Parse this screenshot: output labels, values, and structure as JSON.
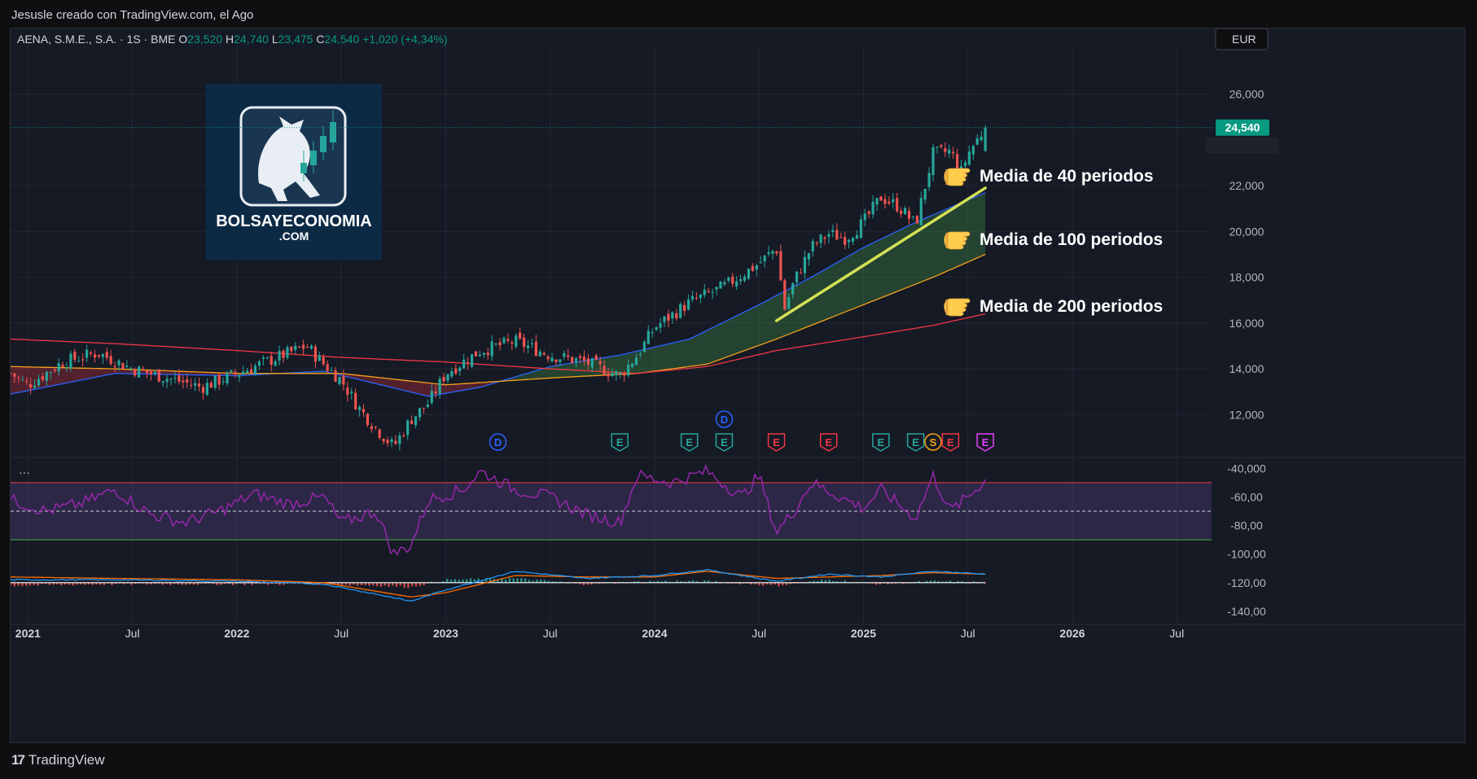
{
  "caption": "Jesusle creado con TradingView.com, el Ago",
  "footer": {
    "brand": "TradingView"
  },
  "legend": {
    "symbol": "AENA, S.M.E., S.A. · 1S · BME",
    "o_label": "O",
    "o_value": "23,520",
    "h_label": "H",
    "h_value": "24,740",
    "l_label": "L",
    "l_value": "23,475",
    "c_label": "C",
    "c_value": "24,540",
    "change": "+1,020 (+4,34%)"
  },
  "currency": "EUR",
  "last_price_label": "24,540",
  "logo": {
    "line1": "BOLSAYECONOMIA",
    "line2": ".COM"
  },
  "annotations": [
    {
      "text": "Media de 40 periodos",
      "icon": "pointing-hand-icon",
      "price": 21800
    },
    {
      "text": "Media de 100 periodos",
      "icon": "pointing-hand-icon",
      "price": 19200
    },
    {
      "text": "Media de 200 periodos",
      "icon": "pointing-hand-icon",
      "price": 16400
    }
  ],
  "indicator_menu": "···",
  "colors": {
    "up": "#26a69a",
    "down": "#ef5350",
    "sma40": "#2962ff",
    "sma100": "#f7a21b",
    "sma200": "#f23645",
    "rsi": "#9c27b0",
    "macd": "#2196f3",
    "signal": "#ff6d00",
    "trendline": "#d4e157",
    "accent": "#089981"
  },
  "chart_data": {
    "type": "candlestick",
    "title": "AENA, S.M.E., S.A. · 1S · BME",
    "price_axis": {
      "ticks": [
        "26,000",
        "22,000",
        "20,000",
        "18,000",
        "16,000",
        "14,000",
        "12,000"
      ],
      "tick_values": [
        26000,
        22000,
        20000,
        18000,
        16000,
        14000,
        12000
      ],
      "range": [
        10200,
        27800
      ]
    },
    "x_axis": {
      "labels": [
        "2021",
        "Jul",
        "2022",
        "Jul",
        "2023",
        "Jul",
        "2024",
        "Jul",
        "2025",
        "Jul",
        "2026",
        "Jul"
      ],
      "label_dates": [
        "2021-01",
        "2021-07",
        "2022-01",
        "2022-07",
        "2023-01",
        "2023-07",
        "2024-01",
        "2024-07",
        "2025-01",
        "2025-07",
        "2026-01",
        "2026-07"
      ],
      "range": [
        "2020-12",
        "2026-09"
      ]
    },
    "price_path": [
      [
        "2020-12",
        13800
      ],
      [
        "2021-01",
        13300
      ],
      [
        "2021-03",
        14300
      ],
      [
        "2021-05",
        14700
      ],
      [
        "2021-07",
        14000
      ],
      [
        "2021-09",
        13600
      ],
      [
        "2021-11",
        13200
      ],
      [
        "2022-01",
        13800
      ],
      [
        "2022-03",
        14400
      ],
      [
        "2022-05",
        15000
      ],
      [
        "2022-06",
        14200
      ],
      [
        "2022-07",
        13500
      ],
      [
        "2022-08",
        12300
      ],
      [
        "2022-09",
        11400
      ],
      [
        "2022-10",
        10600
      ],
      [
        "2022-11",
        11800
      ],
      [
        "2022-12",
        12500
      ],
      [
        "2023-01",
        13800
      ],
      [
        "2023-03",
        14800
      ],
      [
        "2023-05",
        15200
      ],
      [
        "2023-07",
        14600
      ],
      [
        "2023-09",
        14300
      ],
      [
        "2023-11",
        13700
      ],
      [
        "2023-12",
        14600
      ],
      [
        "2024-01",
        15800
      ],
      [
        "2024-03",
        16900
      ],
      [
        "2024-05",
        17600
      ],
      [
        "2024-07",
        18600
      ],
      [
        "2024-08",
        19300
      ],
      [
        "2024-08-15",
        16600
      ],
      [
        "2024-09",
        17800
      ],
      [
        "2024-10",
        19300
      ],
      [
        "2024-11",
        19900
      ],
      [
        "2024-12",
        19700
      ],
      [
        "2025-01",
        20400
      ],
      [
        "2025-02",
        21500
      ],
      [
        "2025-03",
        21100
      ],
      [
        "2025-04",
        20300
      ],
      [
        "2025-05",
        23400
      ],
      [
        "2025-06",
        23500
      ],
      [
        "2025-06-20",
        22600
      ],
      [
        "2025-07",
        23400
      ],
      [
        "2025-08",
        24540
      ]
    ],
    "series": [
      {
        "name": "Media de 40 periodos",
        "values": [
          [
            "2020-12",
            12900
          ],
          [
            "2021-06",
            13800
          ],
          [
            "2022-01",
            13700
          ],
          [
            "2022-06",
            13900
          ],
          [
            "2022-12",
            12800
          ],
          [
            "2023-03",
            13200
          ],
          [
            "2023-07",
            14100
          ],
          [
            "2023-11",
            14600
          ],
          [
            "2024-03",
            15300
          ],
          [
            "2024-07",
            16800
          ],
          [
            "2024-10",
            18000
          ],
          [
            "2025-01",
            19300
          ],
          [
            "2025-04",
            20400
          ],
          [
            "2025-08",
            21700
          ]
        ]
      },
      {
        "name": "Media de 100 periodos",
        "values": [
          [
            "2020-12",
            14100
          ],
          [
            "2021-06",
            14000
          ],
          [
            "2022-01",
            13800
          ],
          [
            "2022-07",
            13800
          ],
          [
            "2023-01",
            13300
          ],
          [
            "2023-07",
            13600
          ],
          [
            "2023-12",
            13800
          ],
          [
            "2024-04",
            14200
          ],
          [
            "2024-08",
            15300
          ],
          [
            "2025-01",
            16800
          ],
          [
            "2025-05",
            18000
          ],
          [
            "2025-08",
            19000
          ]
        ]
      },
      {
        "name": "Media de 200 periodos",
        "values": [
          [
            "2020-12",
            15300
          ],
          [
            "2021-06",
            15100
          ],
          [
            "2022-01",
            14800
          ],
          [
            "2022-07",
            14500
          ],
          [
            "2023-01",
            14300
          ],
          [
            "2023-07",
            14000
          ],
          [
            "2023-12",
            13800
          ],
          [
            "2024-04",
            14100
          ],
          [
            "2024-08",
            14800
          ],
          [
            "2025-01",
            15400
          ],
          [
            "2025-05",
            15900
          ],
          [
            "2025-08",
            16400
          ]
        ]
      }
    ],
    "trendline": [
      [
        "2024-08",
        16100
      ],
      [
        "2025-08",
        21900
      ]
    ],
    "events": [
      {
        "label": "D",
        "date": "2023-04",
        "type": "dividend",
        "row": 1
      },
      {
        "label": "E",
        "date": "2023-11",
        "type": "earnings-up",
        "row": 1
      },
      {
        "label": "E",
        "date": "2024-03",
        "type": "earnings-up",
        "row": 1
      },
      {
        "label": "D",
        "date": "2024-05",
        "type": "dividend",
        "row": 0
      },
      {
        "label": "E",
        "date": "2024-05",
        "type": "earnings-up",
        "row": 1
      },
      {
        "label": "E",
        "date": "2024-08",
        "type": "earnings-down",
        "row": 1
      },
      {
        "label": "E",
        "date": "2024-11",
        "type": "earnings-down",
        "row": 1
      },
      {
        "label": "E",
        "date": "2025-02",
        "type": "earnings-up",
        "row": 1
      },
      {
        "label": "E",
        "date": "2025-04",
        "type": "earnings-up",
        "row": 1
      },
      {
        "label": "S",
        "date": "2025-05",
        "type": "split",
        "row": 1
      },
      {
        "label": "E",
        "date": "2025-06",
        "type": "earnings-down",
        "row": 1
      },
      {
        "label": "E",
        "date": "2025-08",
        "type": "earnings-future",
        "row": 1
      }
    ],
    "oscillator": {
      "ticks": [
        "-40,000",
        "-60,00",
        "-80,00",
        "-100,00",
        "-120,00",
        "-140,00"
      ],
      "tick_values": [
        -40,
        -60,
        -80,
        -100,
        -120,
        -140
      ],
      "range": [
        -148,
        -33
      ],
      "upper_band": -50,
      "lower_band": -90,
      "mid": -70,
      "rsi_path": [
        [
          "2020-12",
          -62
        ],
        [
          "2021-02",
          -70
        ],
        [
          "2021-04",
          -65
        ],
        [
          "2021-06",
          -55
        ],
        [
          "2021-08",
          -72
        ],
        [
          "2021-10",
          -78
        ],
        [
          "2021-12",
          -70
        ],
        [
          "2022-02",
          -58
        ],
        [
          "2022-04",
          -65
        ],
        [
          "2022-06",
          -60
        ],
        [
          "2022-07",
          -78
        ],
        [
          "2022-09",
          -70
        ],
        [
          "2022-10",
          -100
        ],
        [
          "2022-11",
          -94
        ],
        [
          "2022-12",
          -62
        ],
        [
          "2023-02",
          -55
        ],
        [
          "2023-03",
          -42
        ],
        [
          "2023-05",
          -55
        ],
        [
          "2023-07",
          -60
        ],
        [
          "2023-09",
          -72
        ],
        [
          "2023-11",
          -78
        ],
        [
          "2023-12",
          -45
        ],
        [
          "2024-02",
          -50
        ],
        [
          "2024-04",
          -42
        ],
        [
          "2024-06",
          -60
        ],
        [
          "2024-07",
          -45
        ],
        [
          "2024-08",
          -85
        ],
        [
          "2024-09",
          -70
        ],
        [
          "2024-10",
          -50
        ],
        [
          "2024-12",
          -62
        ],
        [
          "2025-01",
          -68
        ],
        [
          "2025-02",
          -55
        ],
        [
          "2025-04",
          -75
        ],
        [
          "2025-05",
          -45
        ],
        [
          "2025-06",
          -70
        ],
        [
          "2025-07",
          -60
        ],
        [
          "2025-08",
          -48
        ]
      ],
      "macd_path": [
        [
          "2020-12",
          -118
        ],
        [
          "2021-06",
          -118
        ],
        [
          "2022-01",
          -119
        ],
        [
          "2022-06",
          -121
        ],
        [
          "2022-09",
          -128
        ],
        [
          "2022-11",
          -133
        ],
        [
          "2023-01",
          -125
        ],
        [
          "2023-05",
          -112
        ],
        [
          "2023-09",
          -117
        ],
        [
          "2024-01",
          -115
        ],
        [
          "2024-04",
          -111
        ],
        [
          "2024-08",
          -119
        ],
        [
          "2024-11",
          -114
        ],
        [
          "2025-02",
          -116
        ],
        [
          "2025-05",
          -112
        ],
        [
          "2025-08",
          -114
        ]
      ],
      "signal_path": [
        [
          "2020-12",
          -116
        ],
        [
          "2021-06",
          -117
        ],
        [
          "2022-01",
          -118
        ],
        [
          "2022-06",
          -120
        ],
        [
          "2022-09",
          -126
        ],
        [
          "2022-11",
          -130
        ],
        [
          "2023-01",
          -127
        ],
        [
          "2023-05",
          -115
        ],
        [
          "2023-09",
          -116
        ],
        [
          "2024-01",
          -116
        ],
        [
          "2024-04",
          -112
        ],
        [
          "2024-08",
          -117
        ],
        [
          "2024-11",
          -116
        ],
        [
          "2025-02",
          -115
        ],
        [
          "2025-05",
          -113
        ],
        [
          "2025-08",
          -114
        ]
      ],
      "zero_line": -120
    }
  }
}
